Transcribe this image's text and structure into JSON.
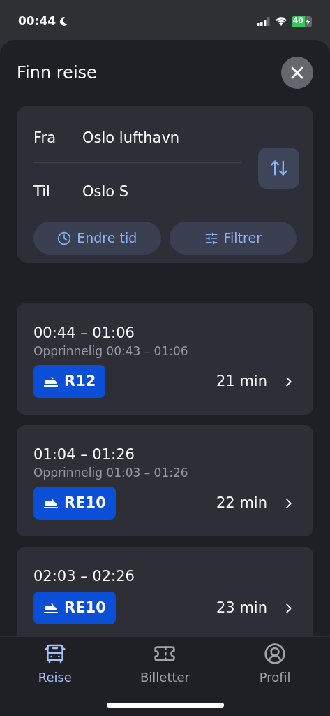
{
  "status_bar": {
    "time": "00:44",
    "battery": "40"
  },
  "header": {
    "title": "Finn reise"
  },
  "search": {
    "from_label": "Fra",
    "from_value": "Oslo lufthavn",
    "to_label": "Til",
    "to_value": "Oslo S",
    "buttons": [
      {
        "label": "Endre tid",
        "kind": "time"
      },
      {
        "label": "Filtrer",
        "kind": "filter"
      }
    ]
  },
  "trips": [
    {
      "times": "00:44 – 01:06",
      "original": "Opprinnelig 00:43 – 01:06",
      "line": "R12",
      "duration": "21 min"
    },
    {
      "times": "01:04 – 01:26",
      "original": "Opprinnelig 01:03 – 01:26",
      "line": "RE10",
      "duration": "22 min"
    },
    {
      "times": "02:03 – 02:26",
      "line": "RE10",
      "duration": "23 min"
    }
  ],
  "tabs": [
    {
      "label": "Reise",
      "kind": "bus",
      "selected": true
    },
    {
      "label": "Billetter",
      "kind": "ticket",
      "selected": false
    },
    {
      "label": "Profil",
      "kind": "profile",
      "selected": false
    }
  ]
}
